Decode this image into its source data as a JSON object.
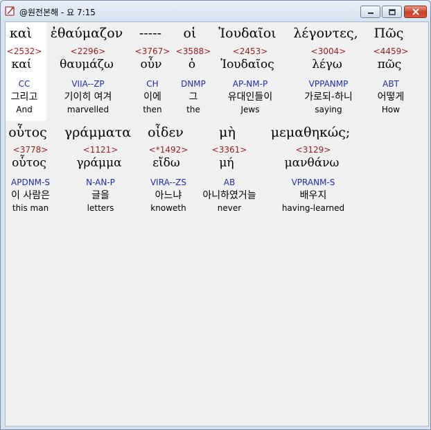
{
  "window": {
    "title": "@원전본해 - 요 7:15"
  },
  "rows": [
    {
      "words": [
        {
          "greek": "καὶ",
          "strong": "<2532>",
          "lemma": "καί",
          "morph": "CC",
          "korean": "그리고",
          "english": "And"
        },
        {
          "greek": "ἐθαύμαζον",
          "strong": "<2296>",
          "lemma": "θαυμάζω",
          "morph": "VIIA--ZP",
          "korean": "기이히 여겨",
          "english": "marvelled"
        },
        {
          "greek": "-----",
          "strong": "<3767>",
          "lemma": "οὖν",
          "morph": "CH",
          "korean": "이에",
          "english": "then"
        },
        {
          "greek": "οἱ",
          "strong": "<3588>",
          "lemma": "ὁ",
          "morph": "DNMP",
          "korean": "그",
          "english": "the"
        },
        {
          "greek": "Ἰουδαῖοι",
          "strong": "<2453>",
          "lemma": "Ἰουδαῖος",
          "morph": "AP-NM-P",
          "korean": "유대인들이",
          "english": "Jews"
        },
        {
          "greek": "λέγοντες,",
          "strong": "<3004>",
          "lemma": "λέγω",
          "morph": "VPPANMP",
          "korean": "가로되-하니",
          "english": "saying"
        },
        {
          "greek": "Πῶς",
          "strong": "<4459>",
          "lemma": "πῶς",
          "morph": "ABT",
          "korean": "어떻게",
          "english": "How"
        }
      ]
    },
    {
      "words": [
        {
          "greek": "οὗτος",
          "strong": "<3778>",
          "lemma": "οὗτος",
          "morph": "APDNM-S",
          "korean": "이 사람은",
          "english": "this man"
        },
        {
          "greek": "γράμματα",
          "strong": "<1121>",
          "lemma": "γράμμα",
          "morph": "N-AN-P",
          "korean": "글을",
          "english": "letters"
        },
        {
          "greek": "οἶδεν",
          "strong": "<*1492>",
          "lemma": "εἴδω",
          "morph": "VIRA--ZS",
          "korean": "아느냐",
          "english": "knoweth"
        },
        {
          "greek": "μὴ",
          "strong": "<3361>",
          "lemma": "μή",
          "morph": "AB",
          "korean": "아니하였거늘",
          "english": "never"
        },
        {
          "greek": "μεμαθηκώς;",
          "strong": "<3129>",
          "lemma": "μανθάνω",
          "morph": "VPRANM-S",
          "korean": "배우지",
          "english": "having-learned"
        }
      ]
    }
  ]
}
